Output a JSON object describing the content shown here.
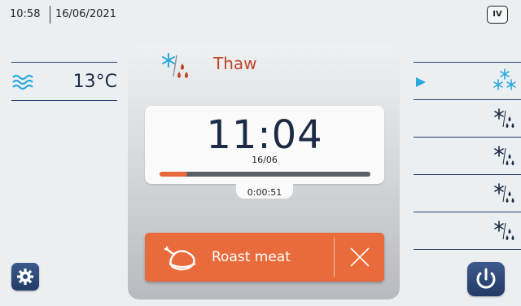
{
  "status_bar": {
    "time": "10:58",
    "date": "16/06/2021",
    "version_badge": "IV"
  },
  "left_panel": {
    "temperature": "13°C",
    "temperature_icon": "air-waves-icon"
  },
  "center": {
    "mode_label": "Thaw",
    "mode_icon": "thaw-icon",
    "timer_value": "11:04",
    "timer_date": "16/06",
    "progress_fraction": 0.13,
    "elapsed": "0:00:51",
    "program_label": "Roast meat",
    "program_icon": "roast-chicken-icon",
    "cancel_icon": "close-icon"
  },
  "right_list": {
    "items": [
      {
        "icon": "deep-freeze-icon",
        "selected": true
      },
      {
        "icon": "thaw-icon",
        "selected": false
      },
      {
        "icon": "thaw-icon",
        "selected": false
      },
      {
        "icon": "thaw-icon",
        "selected": false
      },
      {
        "icon": "thaw-icon",
        "selected": false
      }
    ]
  },
  "buttons": {
    "settings_icon": "gear-icon",
    "power_icon": "power-icon"
  },
  "colors": {
    "accent_orange": "#e96a3b",
    "thaw_red": "#c0462a",
    "snow_blue": "#29a8e0",
    "navy": "#1c2b44",
    "button_navy": "#2d4a7c"
  }
}
